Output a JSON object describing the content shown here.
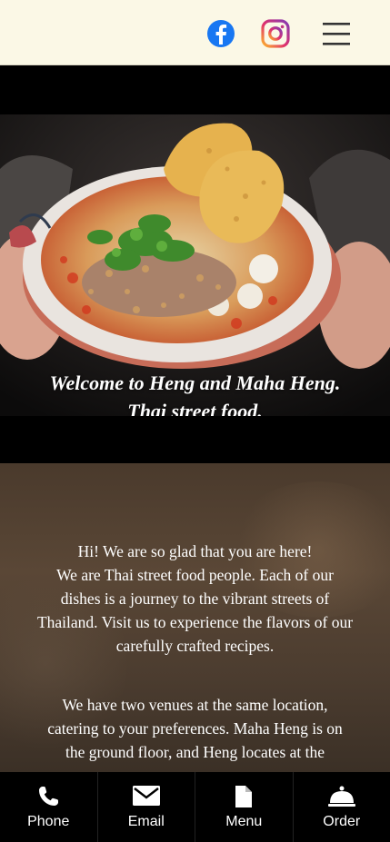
{
  "header": {
    "facebook_icon": "facebook-icon",
    "instagram_icon": "instagram-icon",
    "menu_icon": "hamburger-menu-icon",
    "background_color": "#fbf8e6"
  },
  "hero": {
    "title_line1": "Welcome to Heng and Maha Heng.",
    "title_line2": "Thai street food."
  },
  "intro": {
    "line1": "Hi! We are so glad that you are here!",
    "line2": "We are Thai street food people. Each of our dishes is a journey to the vibrant streets of Thailand. Visit us to experience the flavors of our carefully crafted recipes.",
    "venues": "We have two venues at the same location, catering to your preferences. Maha Heng is on the ground floor, and Heng locates at the"
  },
  "bottom_nav": {
    "items": [
      {
        "label": "Phone",
        "icon": "phone-icon"
      },
      {
        "label": "Email",
        "icon": "envelope-icon"
      },
      {
        "label": "Menu",
        "icon": "document-icon"
      },
      {
        "label": "Order",
        "icon": "service-bell-icon"
      }
    ]
  }
}
